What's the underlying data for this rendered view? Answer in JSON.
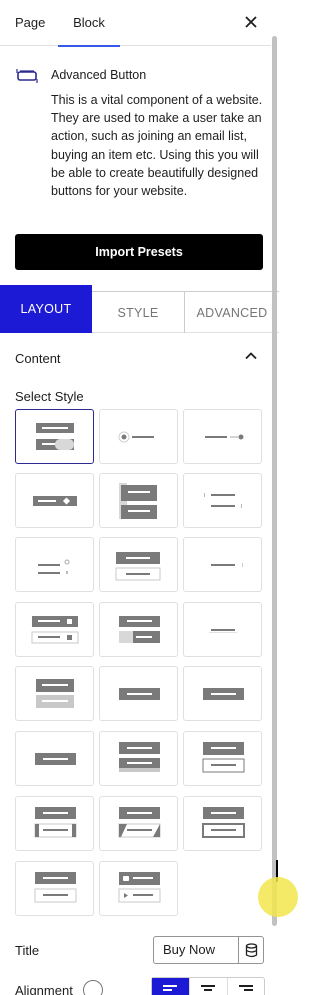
{
  "tabs": {
    "page": "Page",
    "block": "Block"
  },
  "block": {
    "name": "Advanced Button",
    "icon": "button-icon",
    "description": "This is a vital component of a website. They are used to make a user take an action, such as joining an email list, buying an item etc. Using this you will be able to create beautifully designed buttons for your website."
  },
  "import_presets": "Import Presets",
  "panel_tabs": {
    "layout": "LAYOUT",
    "style": "STYLE",
    "advanced": "ADVANCED"
  },
  "content": {
    "title": "Content",
    "select_style_label": "Select Style",
    "selected_style_index": 0
  },
  "title_field": {
    "label": "Title",
    "value": "Buy Now"
  },
  "alignment": {
    "label": "Alignment",
    "selected": "left"
  },
  "colors": {
    "accent": "#1d1ad6",
    "primary_tab_blue": "#3858e9",
    "preview_gray": "#7a7a7a"
  }
}
